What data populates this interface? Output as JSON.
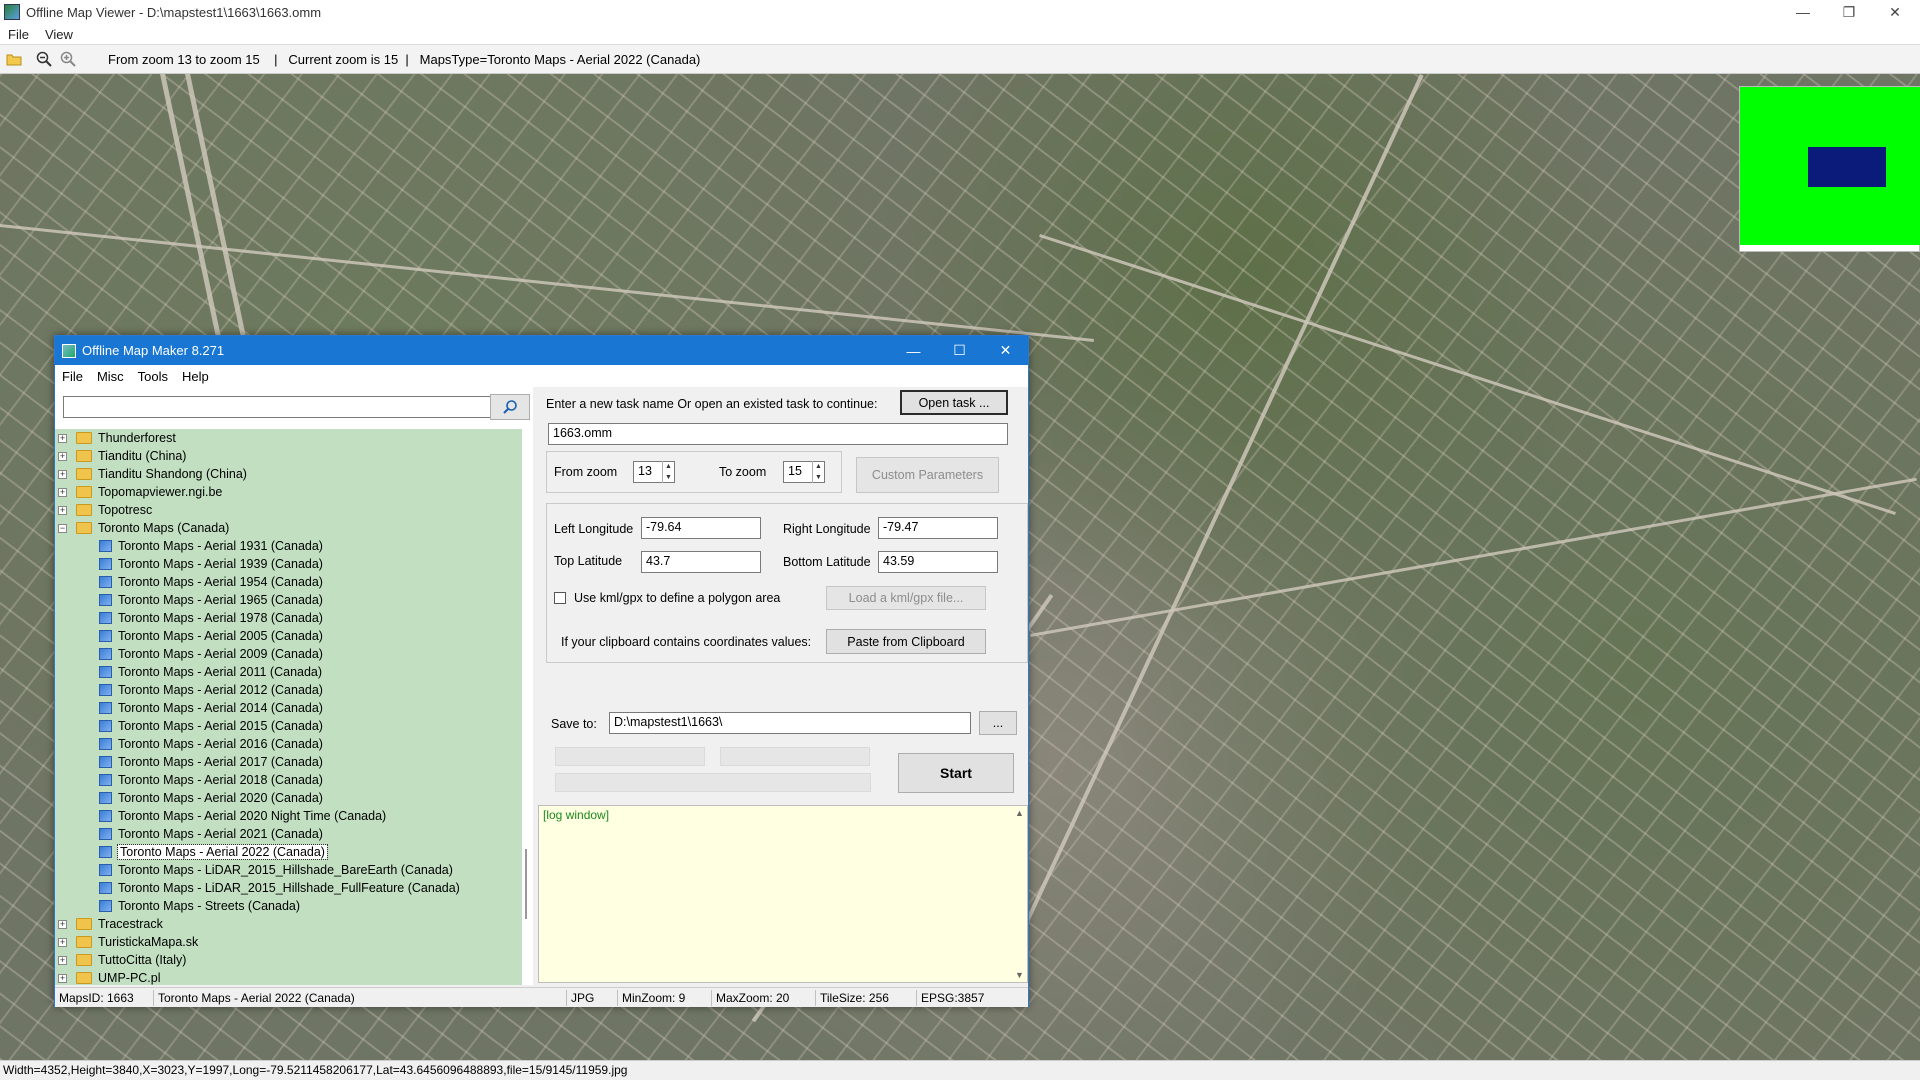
{
  "viewer": {
    "title": "Offline Map Viewer - D:\\mapstest1\\1663\\1663.omm",
    "menu": [
      "File",
      "View"
    ],
    "toolbar_info": "From zoom 13 to zoom 15    |   Current zoom is 15  |   MapsType=Toronto Maps - Aerial 2022 (Canada)",
    "status": "Width=4352,Height=3840,X=3023,Y=1997,Long=-79.5211458206177,Lat=43.6456096488893,file=15/9145/11959.jpg",
    "overview_colors": {
      "background": "#00ff00",
      "viewport": "#0a1b7a"
    }
  },
  "dialog": {
    "title": "Offline Map Maker 8.271",
    "menu": [
      "File",
      "Misc",
      "Tools",
      "Help"
    ],
    "search_value": "",
    "tree": [
      {
        "label": "Thunderforest",
        "type": "folder",
        "expanded": false
      },
      {
        "label": "Tianditu (China)",
        "type": "folder",
        "expanded": false
      },
      {
        "label": "Tianditu Shandong (China)",
        "type": "folder",
        "expanded": false
      },
      {
        "label": "Topomapviewer.ngi.be",
        "type": "folder",
        "expanded": false
      },
      {
        "label": "Topotresc",
        "type": "folder",
        "expanded": false
      },
      {
        "label": "Toronto Maps (Canada)",
        "type": "folder",
        "expanded": true
      },
      {
        "label": "Toronto Maps - Aerial 1931 (Canada)",
        "type": "map"
      },
      {
        "label": "Toronto Maps - Aerial 1939 (Canada)",
        "type": "map"
      },
      {
        "label": "Toronto Maps - Aerial 1954 (Canada)",
        "type": "map"
      },
      {
        "label": "Toronto Maps - Aerial 1965 (Canada)",
        "type": "map"
      },
      {
        "label": "Toronto Maps - Aerial 1978 (Canada)",
        "type": "map"
      },
      {
        "label": "Toronto Maps - Aerial 2005 (Canada)",
        "type": "map"
      },
      {
        "label": "Toronto Maps - Aerial 2009 (Canada)",
        "type": "map"
      },
      {
        "label": "Toronto Maps - Aerial 2011 (Canada)",
        "type": "map"
      },
      {
        "label": "Toronto Maps - Aerial 2012 (Canada)",
        "type": "map"
      },
      {
        "label": "Toronto Maps - Aerial 2014 (Canada)",
        "type": "map"
      },
      {
        "label": "Toronto Maps - Aerial 2015 (Canada)",
        "type": "map"
      },
      {
        "label": "Toronto Maps - Aerial 2016 (Canada)",
        "type": "map"
      },
      {
        "label": "Toronto Maps - Aerial 2017 (Canada)",
        "type": "map"
      },
      {
        "label": "Toronto Maps - Aerial 2018 (Canada)",
        "type": "map"
      },
      {
        "label": "Toronto Maps - Aerial 2020 (Canada)",
        "type": "map"
      },
      {
        "label": "Toronto Maps - Aerial 2020 Night Time (Canada)",
        "type": "map"
      },
      {
        "label": "Toronto Maps - Aerial 2021 (Canada)",
        "type": "map"
      },
      {
        "label": "Toronto Maps - Aerial 2022 (Canada)",
        "type": "map",
        "selected": true
      },
      {
        "label": "Toronto Maps - LiDAR_2015_Hillshade_BareEarth (Canada)",
        "type": "map"
      },
      {
        "label": "Toronto Maps - LiDAR_2015_Hillshade_FullFeature (Canada)",
        "type": "map"
      },
      {
        "label": "Toronto Maps - Streets (Canada)",
        "type": "map"
      },
      {
        "label": "Tracestrack",
        "type": "folder",
        "expanded": false
      },
      {
        "label": "TuristickaMapa.sk",
        "type": "folder",
        "expanded": false
      },
      {
        "label": "TuttoCitta (Italy)",
        "type": "folder",
        "expanded": false
      },
      {
        "label": "UMP-PC.pl",
        "type": "folder",
        "expanded": false
      }
    ],
    "task_prompt": "Enter a new task name Or open an existed task to continue:",
    "open_task_label": "Open task ...",
    "task_name": "1663.omm",
    "from_zoom_label": "From zoom",
    "from_zoom": "13",
    "to_zoom_label": "To zoom",
    "to_zoom": "15",
    "custom_params_label": "Custom Parameters",
    "left_lon_label": "Left Longitude",
    "left_lon": "-79.64",
    "right_lon_label": "Right Longitude",
    "right_lon": "-79.47",
    "top_lat_label": "Top Latitude",
    "top_lat": "43.7",
    "bottom_lat_label": "Bottom Latitude",
    "bottom_lat": "43.59",
    "kml_label": "Use kml/gpx to define a polygon area",
    "load_kml_label": "Load a kml/gpx file...",
    "clipboard_prompt": "If your clipboard contains coordinates values:",
    "paste_label": "Paste from Clipboard",
    "save_to_label": "Save to:",
    "save_to": "D:\\mapstest1\\1663\\",
    "browse_label": "...",
    "start_label": "Start",
    "log_text": "[log window]",
    "status": {
      "maps_id": "MapsID: 1663",
      "map_name": "Toronto Maps - Aerial 2022 (Canada)",
      "format": "JPG",
      "min_zoom": "MinZoom: 9",
      "max_zoom": "MaxZoom: 20",
      "tile_size": "TileSize: 256",
      "epsg": "EPSG:3857"
    }
  }
}
